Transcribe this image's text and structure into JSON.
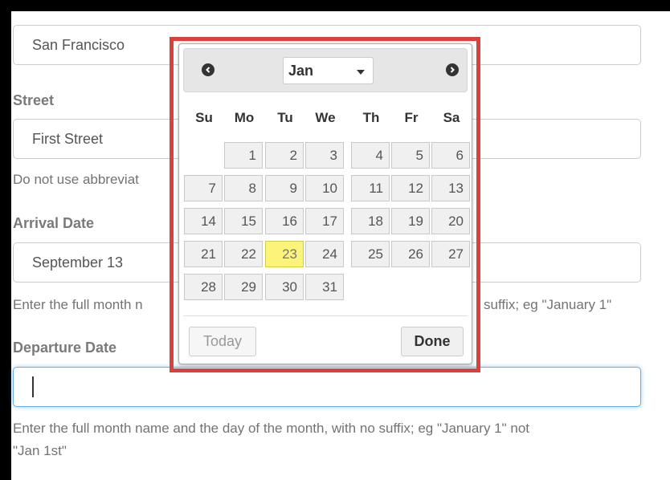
{
  "form": {
    "city_value": "San Francisco",
    "street_label": "Street",
    "street_value": "First Street",
    "street_help": "Do not use abbreviat",
    "arrival_label": "Arrival Date",
    "arrival_value": "September 13",
    "arrival_help_left": "Enter the full month n",
    "arrival_help_right": "suffix; eg \"January 1\"",
    "departure_label": "Departure Date",
    "departure_value": "",
    "departure_help_line1": "Enter the full month name and the day of the month, with no suffix; eg \"January 1\" not",
    "departure_help_line2": "\"Jan 1st\""
  },
  "datepicker": {
    "month_selected": "Jan",
    "weekdays": [
      "Su",
      "Mo",
      "Tu",
      "We",
      "Th",
      "Fr",
      "Sa"
    ],
    "first_weekday_index": 1,
    "days": [
      "1",
      "2",
      "3",
      "4",
      "5",
      "6",
      "7",
      "8",
      "9",
      "10",
      "11",
      "12",
      "13",
      "14",
      "15",
      "16",
      "17",
      "18",
      "19",
      "20",
      "21",
      "22",
      "23",
      "24",
      "25",
      "26",
      "27",
      "28",
      "29",
      "30",
      "31"
    ],
    "highlighted_day": "23",
    "today_label": "Today",
    "done_label": "Done"
  },
  "colors": {
    "highlight_border": "#d9413a",
    "today_highlight": "#fcf37a",
    "focus_border": "#66afe9"
  },
  "icons": {
    "prev": "chevron-left-circle-icon",
    "next": "chevron-right-circle-icon",
    "month_dropdown": "caret-down-icon"
  }
}
